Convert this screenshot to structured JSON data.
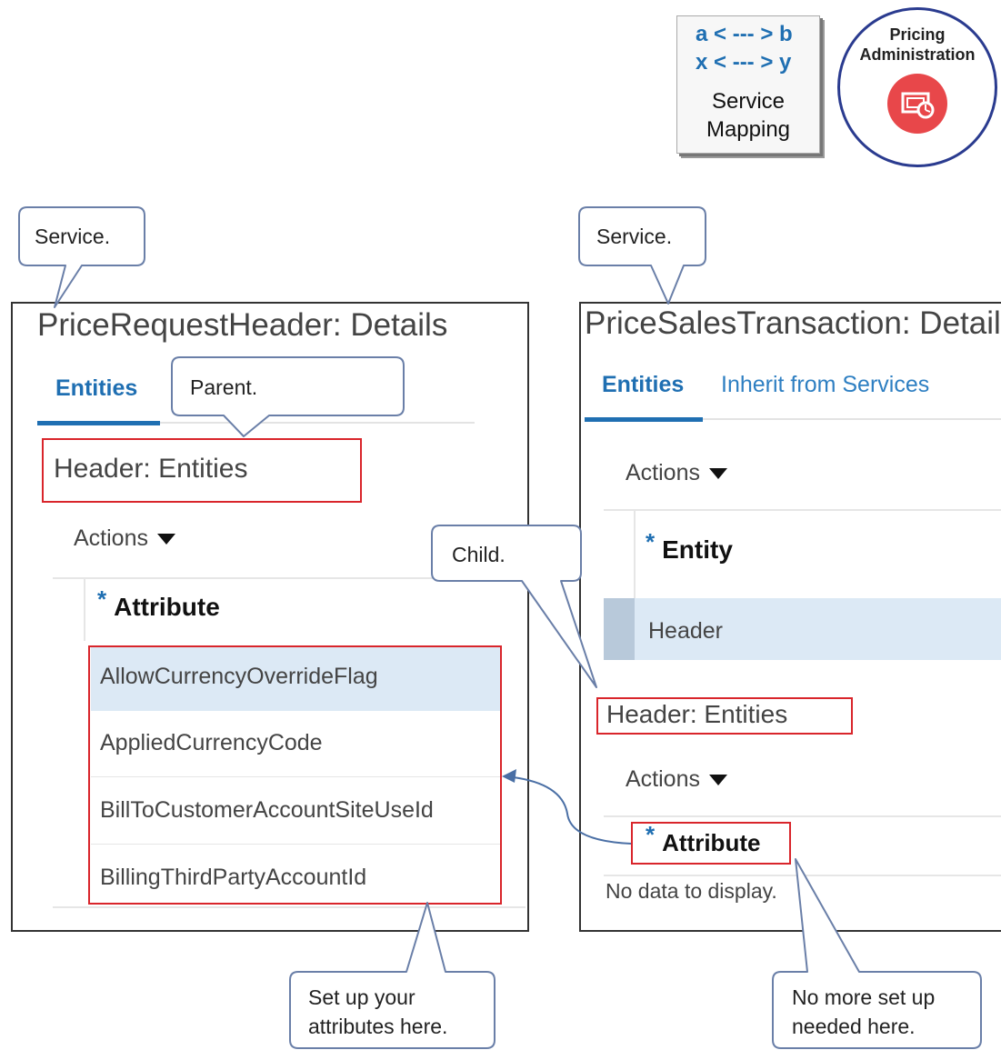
{
  "tiles": {
    "service_mapping": {
      "line1": "a < --- > b",
      "line2": "x < --- > y",
      "label_line1": "Service",
      "label_line2": "Mapping"
    },
    "pricing_administration": {
      "label_line1": "Pricing",
      "label_line2": "Administration",
      "icon": "pricing-admin-icon",
      "accent": "#e8474a"
    }
  },
  "callouts": {
    "service_left": "Service.",
    "service_right": "Service.",
    "parent": "Parent.",
    "child": "Child.",
    "setup_line1": "Set up your",
    "setup_line2": "attributes here.",
    "nomore_line1": "No more set up",
    "nomore_line2": "needed here."
  },
  "left_panel": {
    "title": "PriceRequestHeader: Details",
    "tab_entities": "Entities",
    "section_title": "Header: Entities",
    "actions": "Actions",
    "column_header": "Attribute",
    "rows": [
      "AllowCurrencyOverrideFlag",
      "AppliedCurrencyCode",
      "BillToCustomerAccountSiteUseId",
      "BillingThirdPartyAccountId"
    ]
  },
  "right_panel": {
    "title": "PriceSalesTransaction: Details",
    "tab_entities": "Entities",
    "tab_inherit": "Inherit from Services",
    "actions_top": "Actions",
    "entity_header": "Entity",
    "entity_row": "Header",
    "section_title": "Header: Entities",
    "actions_bottom": "Actions",
    "attribute_header": "Attribute",
    "no_data": "No data to display."
  },
  "colors": {
    "accent_blue": "#1f6fb2",
    "highlight_red": "#d9252b",
    "selected_row": "#dce9f5"
  }
}
